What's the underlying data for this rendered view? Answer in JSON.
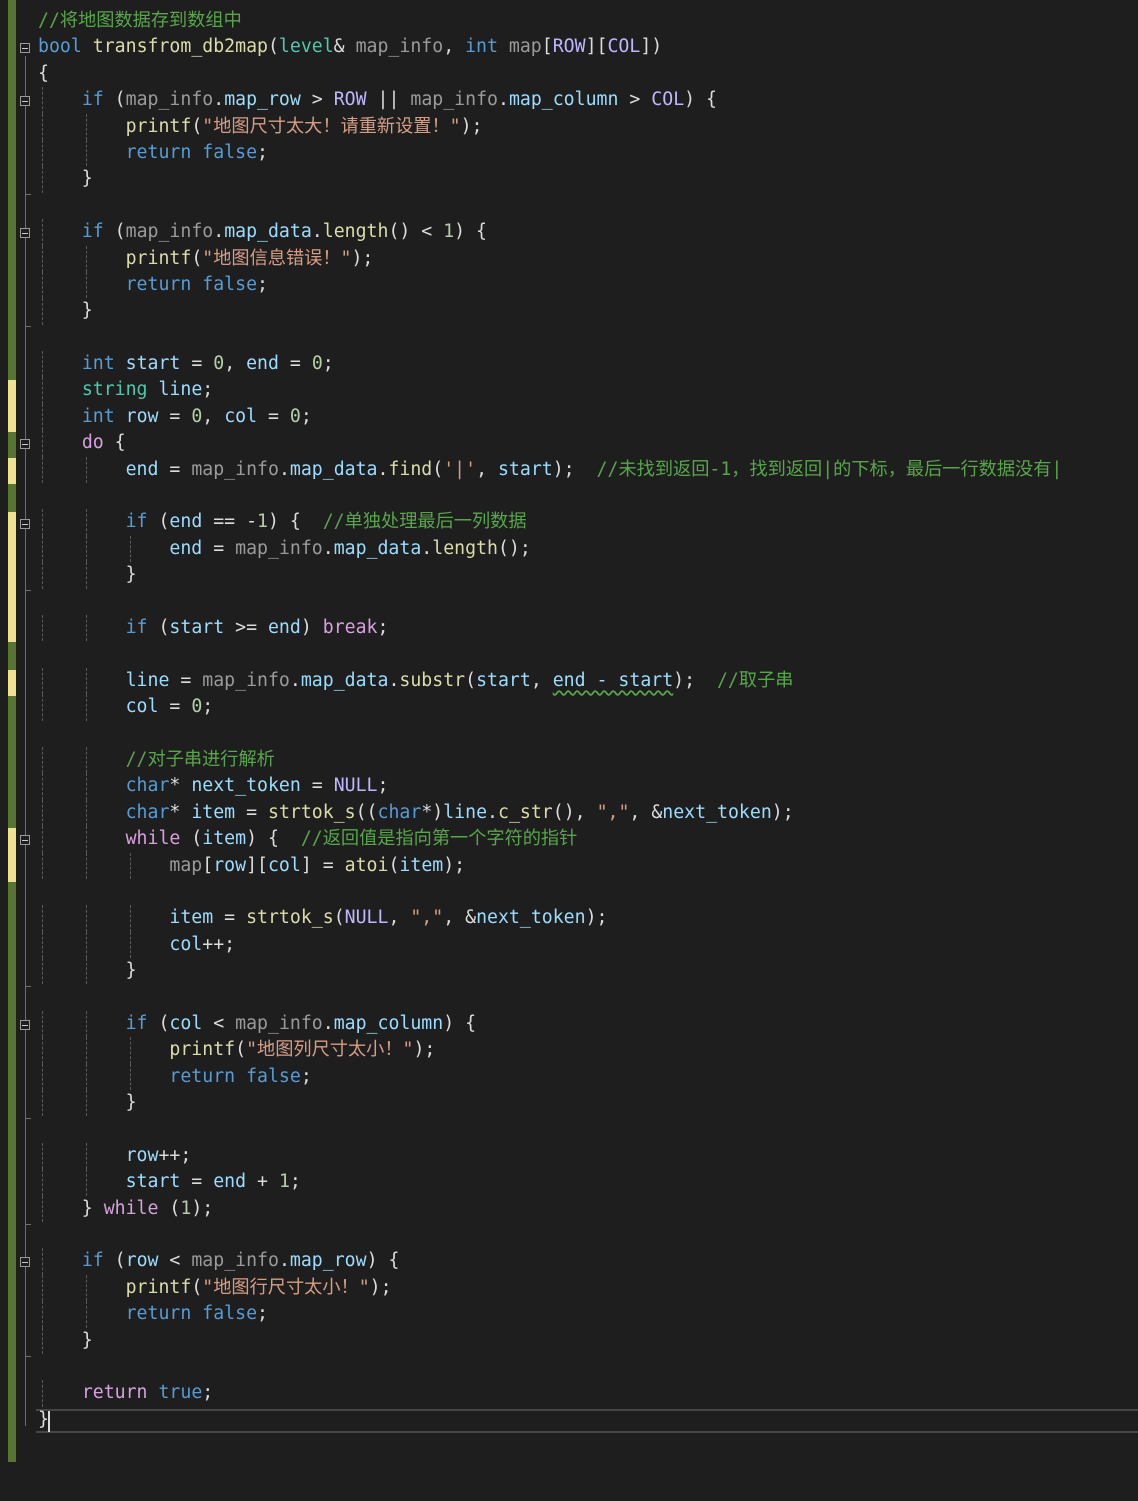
{
  "editor": {
    "language": "cpp",
    "colors": {
      "background": "#1e1e1e",
      "keyword": "#569cd6",
      "function": "#dcdcaa",
      "string": "#d69d85",
      "comment": "#57a64a",
      "macro": "#beb7ff",
      "parameter": "#9a9a9a",
      "variable": "#9cdcfe",
      "changebar": "#577430",
      "changebar_unsaved": "#efe28f"
    },
    "lines": [
      [
        [
          "com",
          "//将地图数据存到数组中"
        ]
      ],
      [
        [
          "kw",
          "bool"
        ],
        [
          "pl",
          " "
        ],
        [
          "fn",
          "transfrom_db2map"
        ],
        [
          "pl",
          "("
        ],
        [
          "type",
          "level"
        ],
        [
          "pl",
          "& "
        ],
        [
          "par",
          "map_info"
        ],
        [
          "pl",
          ", "
        ],
        [
          "kw",
          "int"
        ],
        [
          "pl",
          " "
        ],
        [
          "par",
          "map"
        ],
        [
          "pl",
          "["
        ],
        [
          "mac",
          "ROW"
        ],
        [
          "pl",
          "]["
        ],
        [
          "mac",
          "COL"
        ],
        [
          "pl",
          "])"
        ]
      ],
      [
        [
          "pl",
          "{"
        ]
      ],
      [
        [
          "pl",
          "    "
        ],
        [
          "kw",
          "if"
        ],
        [
          "pl",
          " ("
        ],
        [
          "par",
          "map_info"
        ],
        [
          "pl",
          "."
        ],
        [
          "var",
          "map_row"
        ],
        [
          "pl",
          " > "
        ],
        [
          "mac",
          "ROW"
        ],
        [
          "pl",
          " || "
        ],
        [
          "par",
          "map_info"
        ],
        [
          "pl",
          "."
        ],
        [
          "var",
          "map_column"
        ],
        [
          "pl",
          " > "
        ],
        [
          "mac",
          "COL"
        ],
        [
          "pl",
          ") {"
        ]
      ],
      [
        [
          "pl",
          "        "
        ],
        [
          "fn",
          "printf"
        ],
        [
          "pl",
          "("
        ],
        [
          "str",
          "\"地图尺寸太大！请重新设置！\""
        ],
        [
          "pl",
          ");"
        ]
      ],
      [
        [
          "pl",
          "        "
        ],
        [
          "kw",
          "return"
        ],
        [
          "pl",
          " "
        ],
        [
          "kw",
          "false"
        ],
        [
          "pl",
          ";"
        ]
      ],
      [
        [
          "pl",
          "    }"
        ]
      ],
      [
        [
          "pl",
          ""
        ]
      ],
      [
        [
          "pl",
          "    "
        ],
        [
          "kw",
          "if"
        ],
        [
          "pl",
          " ("
        ],
        [
          "par",
          "map_info"
        ],
        [
          "pl",
          "."
        ],
        [
          "var",
          "map_data"
        ],
        [
          "pl",
          "."
        ],
        [
          "fn",
          "length"
        ],
        [
          "pl",
          "() < "
        ],
        [
          "num",
          "1"
        ],
        [
          "pl",
          ") {"
        ]
      ],
      [
        [
          "pl",
          "        "
        ],
        [
          "fn",
          "printf"
        ],
        [
          "pl",
          "("
        ],
        [
          "str",
          "\"地图信息错误！\""
        ],
        [
          "pl",
          ");"
        ]
      ],
      [
        [
          "pl",
          "        "
        ],
        [
          "kw",
          "return"
        ],
        [
          "pl",
          " "
        ],
        [
          "kw",
          "false"
        ],
        [
          "pl",
          ";"
        ]
      ],
      [
        [
          "pl",
          "    }"
        ]
      ],
      [
        [
          "pl",
          ""
        ]
      ],
      [
        [
          "pl",
          "    "
        ],
        [
          "kw",
          "int"
        ],
        [
          "pl",
          " "
        ],
        [
          "var",
          "start"
        ],
        [
          "pl",
          " = "
        ],
        [
          "num",
          "0"
        ],
        [
          "pl",
          ", "
        ],
        [
          "var",
          "end"
        ],
        [
          "pl",
          " = "
        ],
        [
          "num",
          "0"
        ],
        [
          "pl",
          ";"
        ]
      ],
      [
        [
          "pl",
          "    "
        ],
        [
          "type",
          "string"
        ],
        [
          "pl",
          " "
        ],
        [
          "var",
          "line"
        ],
        [
          "pl",
          ";"
        ]
      ],
      [
        [
          "pl",
          "    "
        ],
        [
          "kw",
          "int"
        ],
        [
          "pl",
          " "
        ],
        [
          "var",
          "row"
        ],
        [
          "pl",
          " = "
        ],
        [
          "num",
          "0"
        ],
        [
          "pl",
          ", "
        ],
        [
          "var",
          "col"
        ],
        [
          "pl",
          " = "
        ],
        [
          "num",
          "0"
        ],
        [
          "pl",
          ";"
        ]
      ],
      [
        [
          "pl",
          "    "
        ],
        [
          "ctl",
          "do"
        ],
        [
          "pl",
          " {"
        ]
      ],
      [
        [
          "pl",
          "        "
        ],
        [
          "var",
          "end"
        ],
        [
          "pl",
          " = "
        ],
        [
          "par",
          "map_info"
        ],
        [
          "pl",
          "."
        ],
        [
          "var",
          "map_data"
        ],
        [
          "pl",
          "."
        ],
        [
          "fn",
          "find"
        ],
        [
          "pl",
          "("
        ],
        [
          "str",
          "'|'"
        ],
        [
          "pl",
          ", "
        ],
        [
          "var",
          "start"
        ],
        [
          "pl",
          ");  "
        ],
        [
          "com",
          "//未找到返回-1，找到返回|的下标，最后一行数据没有|"
        ]
      ],
      [
        [
          "pl",
          ""
        ]
      ],
      [
        [
          "pl",
          "        "
        ],
        [
          "kw",
          "if"
        ],
        [
          "pl",
          " ("
        ],
        [
          "var",
          "end"
        ],
        [
          "pl",
          " == -"
        ],
        [
          "num",
          "1"
        ],
        [
          "pl",
          ") {  "
        ],
        [
          "com",
          "//单独处理最后一列数据"
        ]
      ],
      [
        [
          "pl",
          "            "
        ],
        [
          "var",
          "end"
        ],
        [
          "pl",
          " = "
        ],
        [
          "par",
          "map_info"
        ],
        [
          "pl",
          "."
        ],
        [
          "var",
          "map_data"
        ],
        [
          "pl",
          "."
        ],
        [
          "fn",
          "length"
        ],
        [
          "pl",
          "();"
        ]
      ],
      [
        [
          "pl",
          "        }"
        ]
      ],
      [
        [
          "pl",
          ""
        ]
      ],
      [
        [
          "pl",
          "        "
        ],
        [
          "kw",
          "if"
        ],
        [
          "pl",
          " ("
        ],
        [
          "var",
          "start"
        ],
        [
          "pl",
          " >= "
        ],
        [
          "var",
          "end"
        ],
        [
          "pl",
          ") "
        ],
        [
          "ctl",
          "break"
        ],
        [
          "pl",
          ";"
        ]
      ],
      [
        [
          "pl",
          ""
        ]
      ],
      [
        [
          "pl",
          "        "
        ],
        [
          "var",
          "line"
        ],
        [
          "pl",
          " = "
        ],
        [
          "par",
          "map_info"
        ],
        [
          "pl",
          "."
        ],
        [
          "var",
          "map_data"
        ],
        [
          "pl",
          "."
        ],
        [
          "fn",
          "substr"
        ],
        [
          "pl",
          "("
        ],
        [
          "var",
          "start"
        ],
        [
          "pl",
          ", "
        ],
        [
          "sq",
          "end - start"
        ],
        [
          "pl",
          ");  "
        ],
        [
          "com",
          "//取子串"
        ]
      ],
      [
        [
          "pl",
          "        "
        ],
        [
          "var",
          "col"
        ],
        [
          "pl",
          " = "
        ],
        [
          "num",
          "0"
        ],
        [
          "pl",
          ";"
        ]
      ],
      [
        [
          "pl",
          ""
        ]
      ],
      [
        [
          "pl",
          "        "
        ],
        [
          "com",
          "//对子串进行解析"
        ]
      ],
      [
        [
          "pl",
          "        "
        ],
        [
          "kw",
          "char"
        ],
        [
          "pl",
          "* "
        ],
        [
          "var",
          "next_token"
        ],
        [
          "pl",
          " = "
        ],
        [
          "mac",
          "NULL"
        ],
        [
          "pl",
          ";"
        ]
      ],
      [
        [
          "pl",
          "        "
        ],
        [
          "kw",
          "char"
        ],
        [
          "pl",
          "* "
        ],
        [
          "var",
          "item"
        ],
        [
          "pl",
          " = "
        ],
        [
          "fn",
          "strtok_s"
        ],
        [
          "pl",
          "(("
        ],
        [
          "kw",
          "char"
        ],
        [
          "pl",
          "*)"
        ],
        [
          "var",
          "line"
        ],
        [
          "pl",
          "."
        ],
        [
          "fn",
          "c_str"
        ],
        [
          "pl",
          "(), "
        ],
        [
          "str",
          "\",\""
        ],
        [
          "pl",
          ", &"
        ],
        [
          "var",
          "next_token"
        ],
        [
          "pl",
          ");"
        ]
      ],
      [
        [
          "pl",
          "        "
        ],
        [
          "ctl",
          "while"
        ],
        [
          "pl",
          " ("
        ],
        [
          "var",
          "item"
        ],
        [
          "pl",
          ") {  "
        ],
        [
          "com",
          "//返回值是指向第一个字符的指针"
        ]
      ],
      [
        [
          "pl",
          "            "
        ],
        [
          "par",
          "map"
        ],
        [
          "pl",
          "["
        ],
        [
          "var",
          "row"
        ],
        [
          "pl",
          "]["
        ],
        [
          "var",
          "col"
        ],
        [
          "pl",
          "] = "
        ],
        [
          "fn",
          "atoi"
        ],
        [
          "pl",
          "("
        ],
        [
          "var",
          "item"
        ],
        [
          "pl",
          ");"
        ]
      ],
      [
        [
          "pl",
          ""
        ]
      ],
      [
        [
          "pl",
          "            "
        ],
        [
          "var",
          "item"
        ],
        [
          "pl",
          " = "
        ],
        [
          "fn",
          "strtok_s"
        ],
        [
          "pl",
          "("
        ],
        [
          "mac",
          "NULL"
        ],
        [
          "pl",
          ", "
        ],
        [
          "str",
          "\",\""
        ],
        [
          "pl",
          ", &"
        ],
        [
          "var",
          "next_token"
        ],
        [
          "pl",
          ");"
        ]
      ],
      [
        [
          "pl",
          "            "
        ],
        [
          "var",
          "col"
        ],
        [
          "pl",
          "++;"
        ]
      ],
      [
        [
          "pl",
          "        }"
        ]
      ],
      [
        [
          "pl",
          ""
        ]
      ],
      [
        [
          "pl",
          "        "
        ],
        [
          "kw",
          "if"
        ],
        [
          "pl",
          " ("
        ],
        [
          "var",
          "col"
        ],
        [
          "pl",
          " < "
        ],
        [
          "par",
          "map_info"
        ],
        [
          "pl",
          "."
        ],
        [
          "var",
          "map_column"
        ],
        [
          "pl",
          ") {"
        ]
      ],
      [
        [
          "pl",
          "            "
        ],
        [
          "fn",
          "printf"
        ],
        [
          "pl",
          "("
        ],
        [
          "str",
          "\"地图列尺寸太小！\""
        ],
        [
          "pl",
          ");"
        ]
      ],
      [
        [
          "pl",
          "            "
        ],
        [
          "kw",
          "return"
        ],
        [
          "pl",
          " "
        ],
        [
          "kw",
          "false"
        ],
        [
          "pl",
          ";"
        ]
      ],
      [
        [
          "pl",
          "        }"
        ]
      ],
      [
        [
          "pl",
          ""
        ]
      ],
      [
        [
          "pl",
          "        "
        ],
        [
          "var",
          "row"
        ],
        [
          "pl",
          "++;"
        ]
      ],
      [
        [
          "pl",
          "        "
        ],
        [
          "var",
          "start"
        ],
        [
          "pl",
          " = "
        ],
        [
          "var",
          "end"
        ],
        [
          "pl",
          " + "
        ],
        [
          "num",
          "1"
        ],
        [
          "pl",
          ";"
        ]
      ],
      [
        [
          "pl",
          "    } "
        ],
        [
          "ctl",
          "while"
        ],
        [
          "pl",
          " ("
        ],
        [
          "num",
          "1"
        ],
        [
          "pl",
          ");"
        ]
      ],
      [
        [
          "pl",
          ""
        ]
      ],
      [
        [
          "pl",
          "    "
        ],
        [
          "kw",
          "if"
        ],
        [
          "pl",
          " ("
        ],
        [
          "var",
          "row"
        ],
        [
          "pl",
          " < "
        ],
        [
          "par",
          "map_info"
        ],
        [
          "pl",
          "."
        ],
        [
          "var",
          "map_row"
        ],
        [
          "pl",
          ") {"
        ]
      ],
      [
        [
          "pl",
          "        "
        ],
        [
          "fn",
          "printf"
        ],
        [
          "pl",
          "("
        ],
        [
          "str",
          "\"地图行尺寸太小！\""
        ],
        [
          "pl",
          ");"
        ]
      ],
      [
        [
          "pl",
          "        "
        ],
        [
          "kw",
          "return"
        ],
        [
          "pl",
          " "
        ],
        [
          "kw",
          "false"
        ],
        [
          "pl",
          ";"
        ]
      ],
      [
        [
          "pl",
          "    }"
        ]
      ],
      [
        [
          "pl",
          ""
        ]
      ],
      [
        [
          "pl",
          "    "
        ],
        [
          "ctl",
          "return"
        ],
        [
          "pl",
          " "
        ],
        [
          "kw",
          "true"
        ],
        [
          "pl",
          ";"
        ]
      ],
      [
        [
          "pl",
          "}"
        ]
      ]
    ]
  }
}
